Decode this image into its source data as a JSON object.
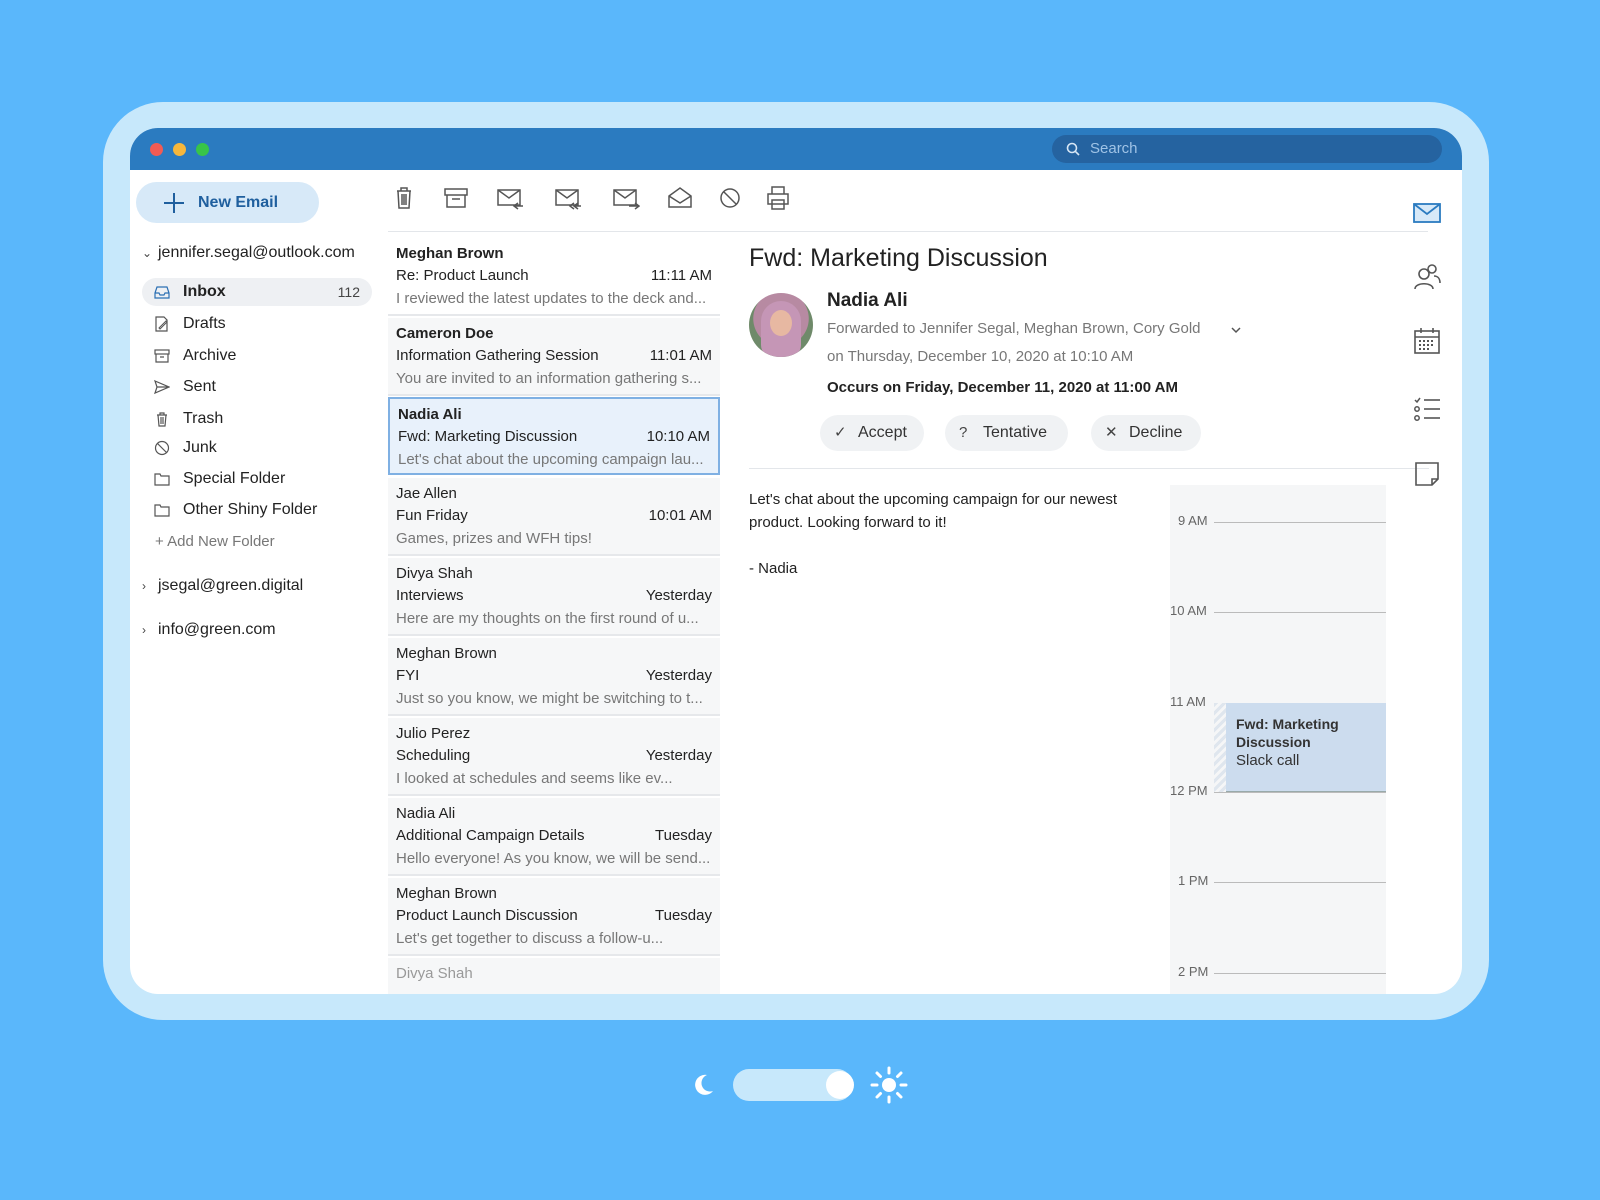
{
  "search": {
    "placeholder": "Search"
  },
  "toolbar": {
    "new_email_label": "New Email"
  },
  "accounts": [
    {
      "email": "jennifer.segal@outlook.com",
      "expanded": true
    },
    {
      "email": "jsegal@green.digital",
      "expanded": false
    },
    {
      "email": "info@green.com",
      "expanded": false
    }
  ],
  "folders": [
    {
      "label": "Inbox",
      "count": "112",
      "icon": "inbox-icon",
      "active": true
    },
    {
      "label": "Drafts",
      "icon": "drafts-icon"
    },
    {
      "label": "Archive",
      "icon": "archive-icon"
    },
    {
      "label": "Sent",
      "icon": "sent-icon"
    },
    {
      "label": "Trash",
      "icon": "trash-icon"
    },
    {
      "label": "Junk",
      "icon": "junk-icon"
    },
    {
      "label": "Special Folder",
      "icon": "folder-icon"
    },
    {
      "label": "Other Shiny Folder",
      "icon": "folder-icon"
    }
  ],
  "add_folder_label": "+ Add New Folder",
  "messages": [
    {
      "sender": "Meghan Brown",
      "subject": "Re: Product Launch",
      "time": "11:11 AM",
      "preview": "I reviewed the latest updates to the deck and...",
      "unread": true
    },
    {
      "sender": "Cameron Doe",
      "subject": "Information Gathering Session",
      "time": "11:01 AM",
      "preview": "You are invited to an information gathering s...",
      "unread": true
    },
    {
      "sender": "Nadia Ali",
      "subject": "Fwd: Marketing Discussion",
      "time": "10:10 AM",
      "preview": "Let's chat about the upcoming campaign lau...",
      "unread": true,
      "selected": true
    },
    {
      "sender": "Jae Allen",
      "subject": "Fun Friday",
      "time": "10:01 AM",
      "preview": "Games, prizes and WFH tips!"
    },
    {
      "sender": "Divya Shah",
      "subject": "Interviews",
      "time": "Yesterday",
      "preview": "Here are my thoughts on the first round of u..."
    },
    {
      "sender": "Meghan Brown",
      "subject": "FYI",
      "time": "Yesterday",
      "preview": "Just so you know, we might be switching to t..."
    },
    {
      "sender": "Julio Perez",
      "subject": "Scheduling",
      "time": "Yesterday",
      "preview": "I looked at schedules and seems like ev..."
    },
    {
      "sender": "Nadia Ali",
      "subject": "Additional Campaign Details",
      "time": "Tuesday",
      "preview": "Hello everyone! As you know, we will be send..."
    },
    {
      "sender": "Meghan Brown",
      "subject": "Product Launch Discussion",
      "time": "Tuesday",
      "preview": "Let's get together to discuss a follow-u..."
    },
    {
      "sender": "Divya Shah",
      "subject": "",
      "time": "",
      "preview": ""
    }
  ],
  "reading": {
    "title": "Fwd: Marketing Discussion",
    "from": "Nadia Ali",
    "forwarded_to": "Forwarded to Jennifer Segal, Meghan Brown, Cory Gold",
    "sent_on": "on Thursday, December 10, 2020 at 10:10 AM",
    "occurs": "Occurs on Friday, December 11, 2020 at 11:00 AM",
    "accept": "Accept",
    "tentative": "Tentative",
    "decline": "Decline",
    "body_line1": "Let's chat about the upcoming campaign for our newest product. Looking forward to it!",
    "body_signoff": "- Nadia"
  },
  "calendar": {
    "hours": [
      "9 AM",
      "10 AM",
      "11 AM",
      "12 PM",
      "1 PM",
      "2 PM"
    ],
    "event": {
      "title": "Fwd: Marketing Discussion",
      "subtitle": "Slack call",
      "start_hour": "11 AM",
      "end_hour": "12 PM"
    }
  },
  "colors": {
    "background": "#5ab7fb",
    "titlebar": "#2b7bc0",
    "accent": "#1f5f9e"
  },
  "theme_toggle": {
    "mode": "light"
  }
}
